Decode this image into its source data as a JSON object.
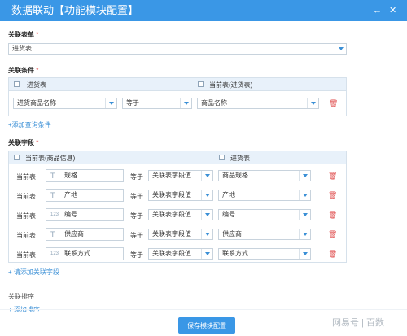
{
  "window": {
    "title": "数据联动【功能模块配置】",
    "controls": [
      "↔",
      "✕"
    ]
  },
  "related_form": {
    "label": "关联表单",
    "required": "*",
    "value": "进货表"
  },
  "conditions": {
    "label": "关联条件",
    "required": "*",
    "left_header": "进货表",
    "right_header": "当前表(进货表)",
    "row": {
      "left_field": "进货商品名称",
      "operator": "等于",
      "right_field": "商品名称"
    },
    "add_link": "+添加查询条件"
  },
  "fields": {
    "label": "关联字段",
    "required": "*",
    "left_header": "当前表(商品信息)",
    "right_header": "进货表",
    "rows": [
      {
        "table": "当前表",
        "icon": "T",
        "field": "规格",
        "operator": "等于",
        "source": "关联表字段值",
        "target": "商品规格"
      },
      {
        "table": "当前表",
        "icon": "T",
        "field": "产地",
        "operator": "等于",
        "source": "关联表字段值",
        "target": "产地"
      },
      {
        "table": "当前表",
        "icon": "123",
        "field": "编号",
        "operator": "等于",
        "source": "关联表字段值",
        "target": "编号"
      },
      {
        "table": "当前表",
        "icon": "T",
        "field": "供应商",
        "operator": "等于",
        "source": "关联表字段值",
        "target": "供应商"
      },
      {
        "table": "当前表",
        "icon": "123",
        "field": "联系方式",
        "operator": "等于",
        "source": "关联表字段值",
        "target": "联系方式"
      }
    ],
    "add_link": "+ 请添加关联字段"
  },
  "sort": {
    "label": "关联排序",
    "add_link": "+ 添加排序"
  },
  "save_button": "保存模块配置",
  "watermark": "网易号 | 百数",
  "colors": {
    "header": "#3a97e6",
    "link": "#3a8fd6",
    "delete": "#e05050"
  }
}
